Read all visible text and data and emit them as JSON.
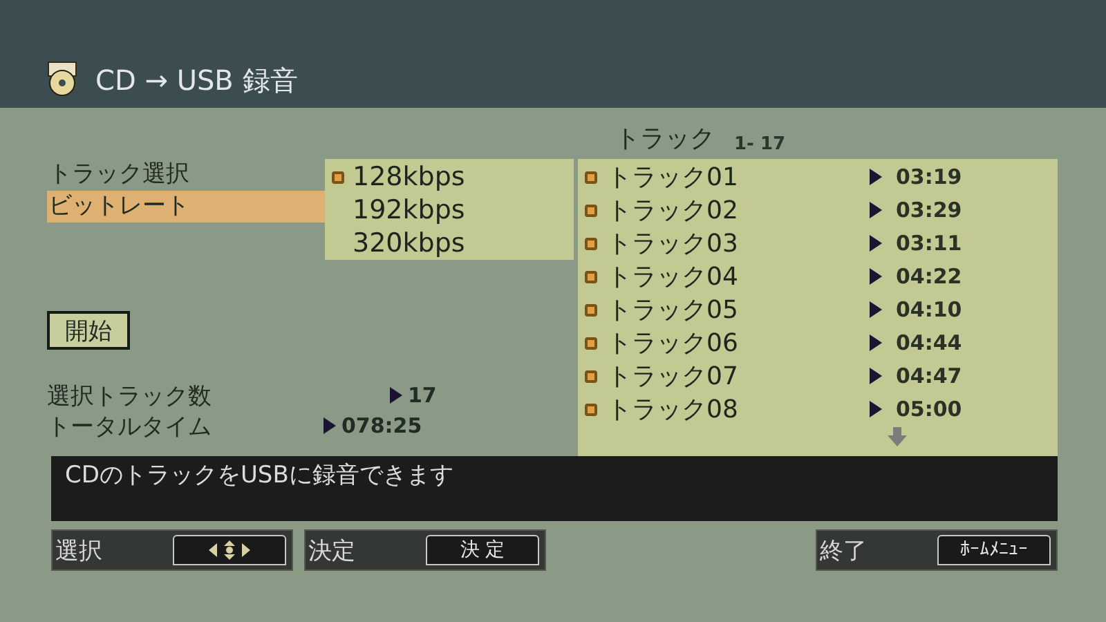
{
  "header": {
    "title": "CD → USB 録音"
  },
  "menu": [
    {
      "label": "トラック選択",
      "selected": false
    },
    {
      "label": "ビットレート",
      "selected": true
    }
  ],
  "bitrate_options": [
    {
      "label": "128kbps",
      "selected": true
    },
    {
      "label": "192kbps",
      "selected": false
    },
    {
      "label": "320kbps",
      "selected": false
    }
  ],
  "start_button": {
    "label": "開始"
  },
  "summary": [
    {
      "label": "選択トラック数",
      "value": "17"
    },
    {
      "label": "トータルタイム",
      "value": "078:25"
    }
  ],
  "track_list": {
    "title": "トラック",
    "range": "1- 17",
    "rows": [
      {
        "name": "トラック01",
        "checked": true,
        "duration": "03:19"
      },
      {
        "name": "トラック02",
        "checked": true,
        "duration": "03:29"
      },
      {
        "name": "トラック03",
        "checked": true,
        "duration": "03:11"
      },
      {
        "name": "トラック04",
        "checked": true,
        "duration": "04:22"
      },
      {
        "name": "トラック05",
        "checked": true,
        "duration": "04:10"
      },
      {
        "name": "トラック06",
        "checked": true,
        "duration": "04:44"
      },
      {
        "name": "トラック07",
        "checked": true,
        "duration": "04:47"
      },
      {
        "name": "トラック08",
        "checked": true,
        "duration": "05:00"
      }
    ],
    "more_below": true
  },
  "message": "CDのトラックをUSBに録音できます",
  "footer": [
    {
      "label": "選択",
      "key": {
        "kind": "arrows"
      }
    },
    {
      "label": "決定",
      "key": {
        "kind": "text",
        "text": "決 定"
      }
    },
    {
      "label": "終了",
      "key": {
        "kind": "text",
        "text": "ﾎｰﾑﾒﾆｭｰ"
      }
    }
  ]
}
